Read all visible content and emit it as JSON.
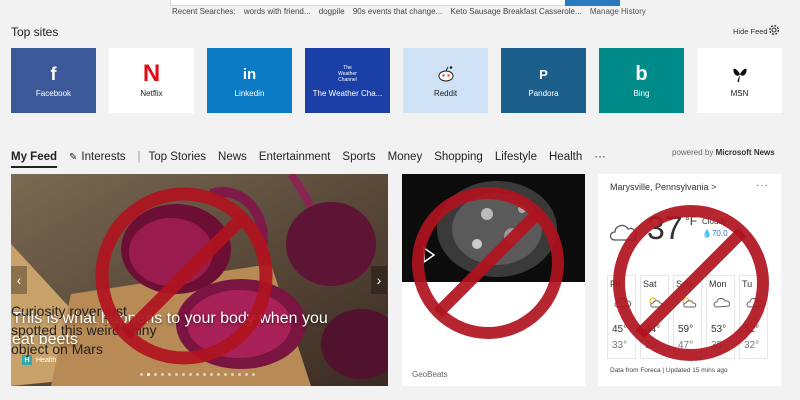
{
  "search": {
    "recent_label": "Recent Searches:",
    "recent_items": [
      "words with friend...",
      "dogpile",
      "90s events that change...",
      "Keto Sausage Breakfast Casserole..."
    ],
    "manage_history": "Manage History"
  },
  "top_sites": {
    "title": "Top sites",
    "hide_feed": "Hide Feed",
    "tiles": [
      {
        "label": "Facebook",
        "logo": "f",
        "color": "#3b5998"
      },
      {
        "label": "Netflix",
        "logo": "N",
        "color": "#ffffff"
      },
      {
        "label": "Linkedin",
        "logo": "in",
        "color": "#0a7bc4"
      },
      {
        "label": "The Weather Cha...",
        "logo": "The Weather Channel",
        "color": "#1a3fa6"
      },
      {
        "label": "Reddit",
        "logo": "reddit-icon",
        "color": "#cfe1f5"
      },
      {
        "label": "Pandora",
        "logo": "P",
        "color": "#1d5f8c"
      },
      {
        "label": "Bing",
        "logo": "b",
        "color": "#008b8b"
      },
      {
        "label": "MSN",
        "logo": "msn-butterfly-icon",
        "color": "#ffffff"
      }
    ]
  },
  "feed_nav": {
    "active": "My Feed",
    "interests": "Interests",
    "items": [
      "Top Stories",
      "News",
      "Entertainment",
      "Sports",
      "Money",
      "Shopping",
      "Lifestyle",
      "Health"
    ],
    "more": "···",
    "powered_prefix": "powered by",
    "powered_brand": "Microsoft News"
  },
  "hero": {
    "title": "This is what happens to your body when you eat beets",
    "source": "Health",
    "source_initial": "H"
  },
  "news2": {
    "title": "Curiosity rover just spotted this weird shiny object on Mars",
    "source": "GeoBeats"
  },
  "weather": {
    "location": "Marysville, Pennsylvania",
    "location_chevron": ">",
    "more": "···",
    "temp": "37",
    "unit": "°F",
    "condition": "Cloudy",
    "precip": "70.0",
    "forecast": [
      {
        "day": "Fri",
        "hi": "45°",
        "lo": "33°"
      },
      {
        "day": "Sat",
        "hi": "44°",
        "lo": "29°"
      },
      {
        "day": "Sun",
        "hi": "59°",
        "lo": "47°"
      },
      {
        "day": "Mon",
        "hi": "53°",
        "lo": "35°"
      },
      {
        "day": "Tu",
        "hi": "52°",
        "lo": "32°"
      }
    ],
    "footer": "Data from Foreca | Updated 15 mins ago"
  },
  "colors": {
    "accent": "#2a7ac0",
    "prohibition_red": "#b0131f"
  }
}
